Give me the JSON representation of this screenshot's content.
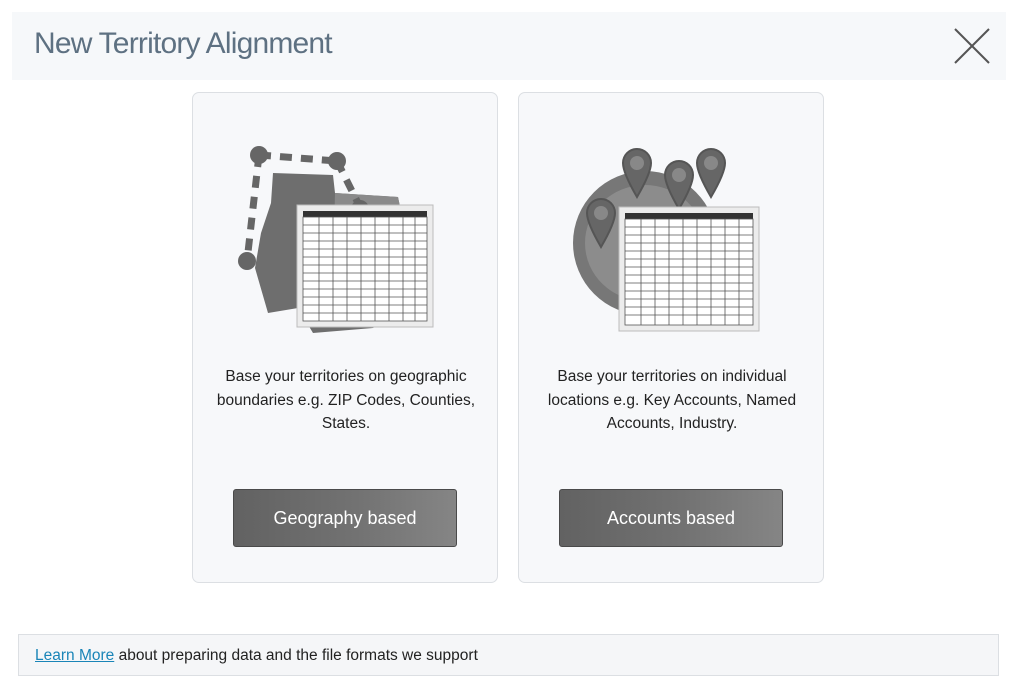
{
  "dialog": {
    "title": "New Territory Alignment",
    "close_icon": "close-icon"
  },
  "cards": {
    "geography": {
      "icon": "geography-map-spreadsheet-icon",
      "description": "Base your territories on geographic boundaries e.g. ZIP Codes, Counties, States.",
      "button_label": "Geography based"
    },
    "accounts": {
      "icon": "accounts-pins-spreadsheet-icon",
      "description": "Base your territories on individual locations e.g. Key Accounts, Named Accounts, Industry.",
      "button_label": "Accounts based"
    }
  },
  "footer": {
    "link_label": "Learn More",
    "text": " about preparing data and the file formats we support"
  },
  "colors": {
    "title": "#5e7182",
    "link": "#1a85b8",
    "button": "#6f6f6f"
  }
}
